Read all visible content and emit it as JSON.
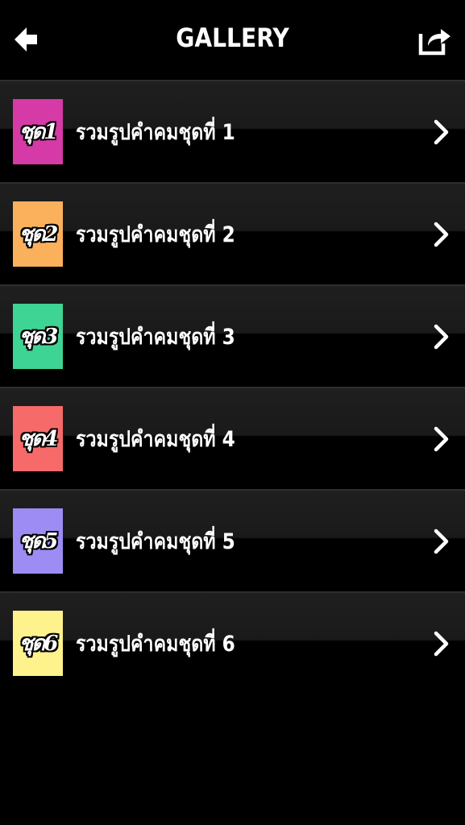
{
  "header": {
    "title": "GALLERY",
    "back_icon": "back-arrow-icon",
    "share_icon": "share-icon"
  },
  "gallery": {
    "items": [
      {
        "thumb_label": "ชุด1",
        "label": "รวมรูปคำคมชุดที่ 1",
        "color": "#d63aa6"
      },
      {
        "thumb_label": "ชุด2",
        "label": "รวมรูปคำคมชุดที่ 2",
        "color": "#fbb05c"
      },
      {
        "thumb_label": "ชุด3",
        "label": "รวมรูปคำคมชุดที่ 3",
        "color": "#3ed494"
      },
      {
        "thumb_label": "ชุด4",
        "label": "รวมรูปคำคมชุดที่ 4",
        "color": "#f76a6a"
      },
      {
        "thumb_label": "ชุด5",
        "label": "รวมรูปคำคมชุดที่ 5",
        "color": "#9c8cf4"
      },
      {
        "thumb_label": "ชุด6",
        "label": "รวมรูปคำคมชุดที่ 6",
        "color": "#fdf28c"
      }
    ],
    "chevron_icon": "chevron-right-icon"
  },
  "colors": {
    "background": "#000000",
    "text": "#ffffff",
    "separator": "#2e2e2e"
  }
}
